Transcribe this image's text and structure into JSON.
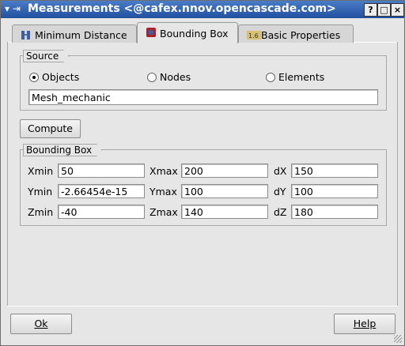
{
  "window": {
    "title": "Measurements <@cafex.nnov.opencascade.com>",
    "buttons": [
      "?",
      "□",
      "×"
    ]
  },
  "tabs": [
    {
      "label": "Minimum Distance",
      "active": false
    },
    {
      "label": "Bounding Box",
      "active": true
    },
    {
      "label": "Basic Properties",
      "active": false
    }
  ],
  "source": {
    "group_label": "Source",
    "options": [
      {
        "label": "Objects",
        "checked": true
      },
      {
        "label": "Nodes",
        "checked": false
      },
      {
        "label": "Elements",
        "checked": false
      }
    ],
    "object_name": "Mesh_mechanic"
  },
  "compute_label": "Compute",
  "bbox": {
    "group_label": "Bounding Box",
    "rows": [
      {
        "l1": "Xmin",
        "v1": "50",
        "l2": "Xmax",
        "v2": "200",
        "l3": "dX",
        "v3": "150"
      },
      {
        "l1": "Ymin",
        "v1": "-2.66454e-15",
        "l2": "Ymax",
        "v2": "100",
        "l3": "dY",
        "v3": "100"
      },
      {
        "l1": "Zmin",
        "v1": "-40",
        "l2": "Zmax",
        "v2": "140",
        "l3": "dZ",
        "v3": "180"
      }
    ]
  },
  "footer": {
    "ok_label": "Ok",
    "help_label": "Help"
  },
  "colors": {
    "titlebar": "#2f5fb0",
    "background": "#e6e6e6"
  }
}
